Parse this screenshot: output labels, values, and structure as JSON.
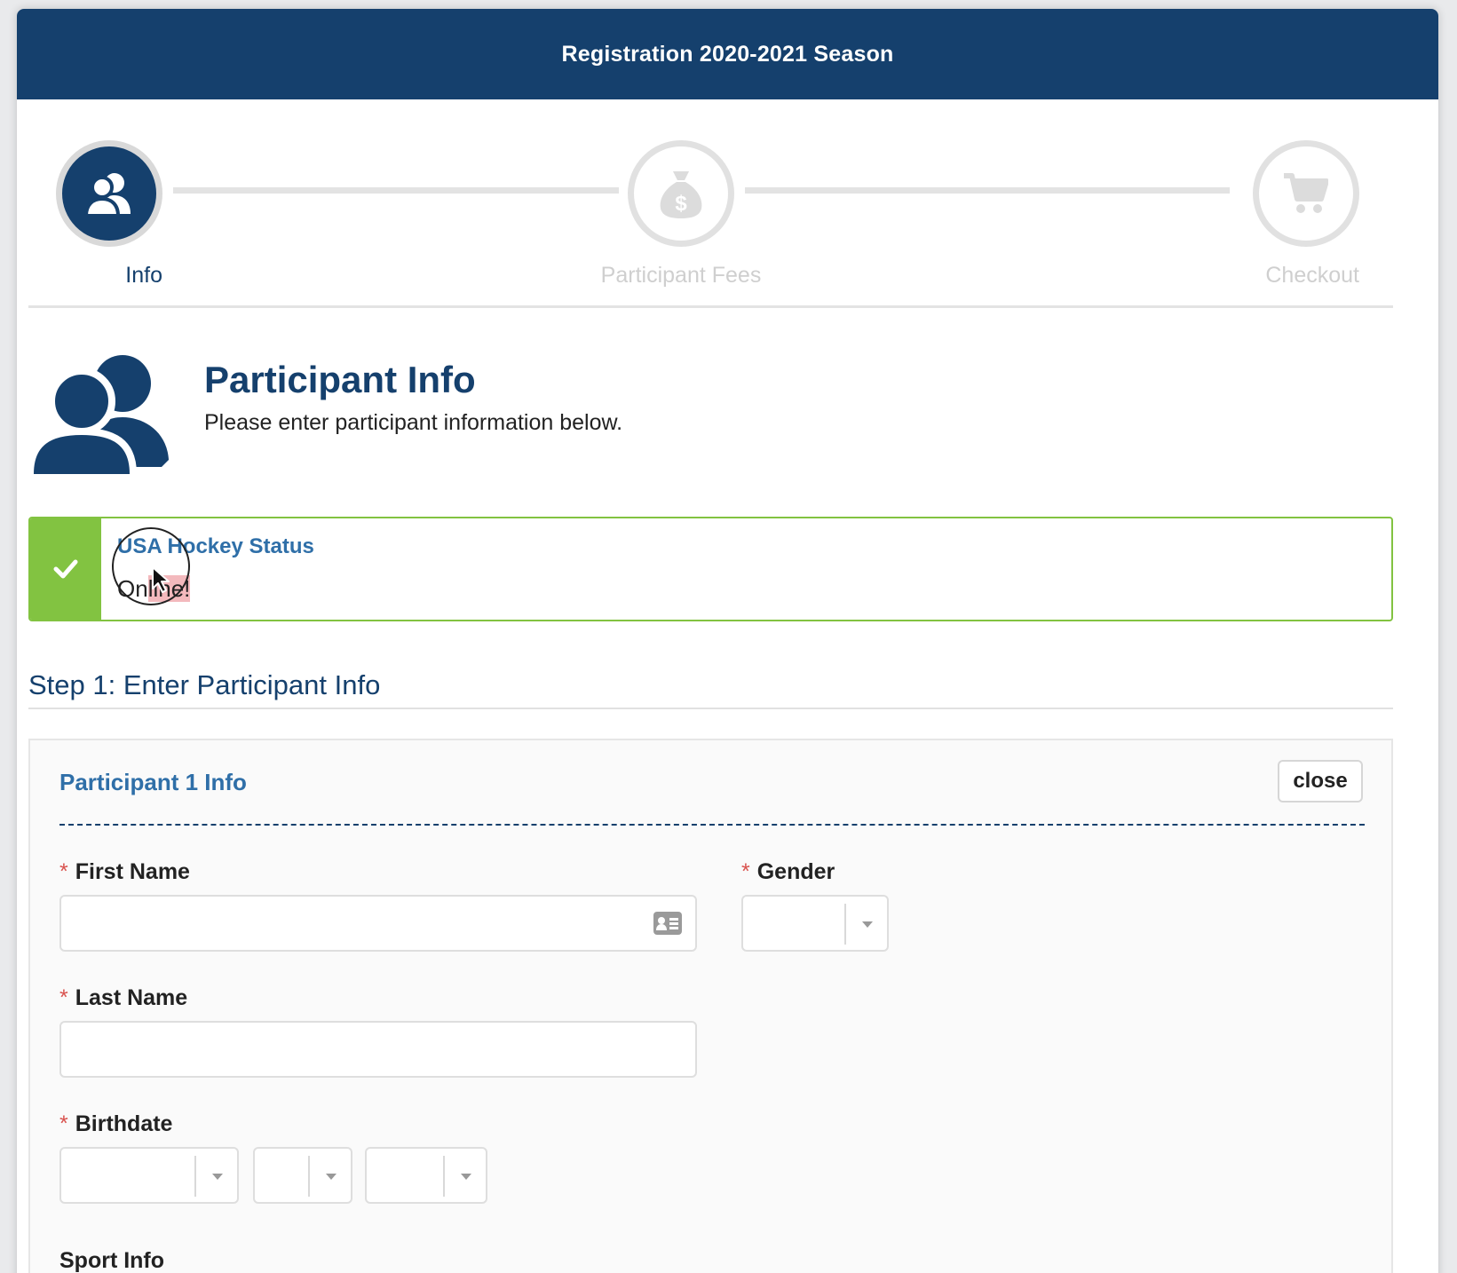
{
  "header": {
    "title": "Registration 2020-2021 Season"
  },
  "stepper": {
    "steps": [
      {
        "label": "Info",
        "icon": "users-icon",
        "state": "active"
      },
      {
        "label": "Participant Fees",
        "icon": "money-bag-icon",
        "state": "inactive"
      },
      {
        "label": "Checkout",
        "icon": "cart-icon",
        "state": "inactive"
      }
    ]
  },
  "page": {
    "title": "Participant Info",
    "subtitle": "Please enter participant information below."
  },
  "status_alert": {
    "title": "USA Hockey Status",
    "text_prefix": "On",
    "text_highlight": "line!",
    "icon": "check-icon",
    "color": "#82c341"
  },
  "step1": {
    "heading": "Step 1: Enter Participant Info"
  },
  "participant": {
    "title": "Participant 1 Info",
    "close_label": "close",
    "first_name": {
      "label": "First Name",
      "value": "",
      "required": "*"
    },
    "gender": {
      "label": "Gender",
      "value": "",
      "required": "*"
    },
    "last_name": {
      "label": "Last Name",
      "value": "",
      "required": "*"
    },
    "birthdate": {
      "label": "Birthdate",
      "required": "*",
      "month": "",
      "day": "",
      "year": ""
    },
    "sport_info": {
      "label": "Sport Info"
    }
  },
  "colors": {
    "brand": "#15406d",
    "link": "#2f6fa8",
    "success": "#82c341",
    "required": "#d9534f"
  }
}
